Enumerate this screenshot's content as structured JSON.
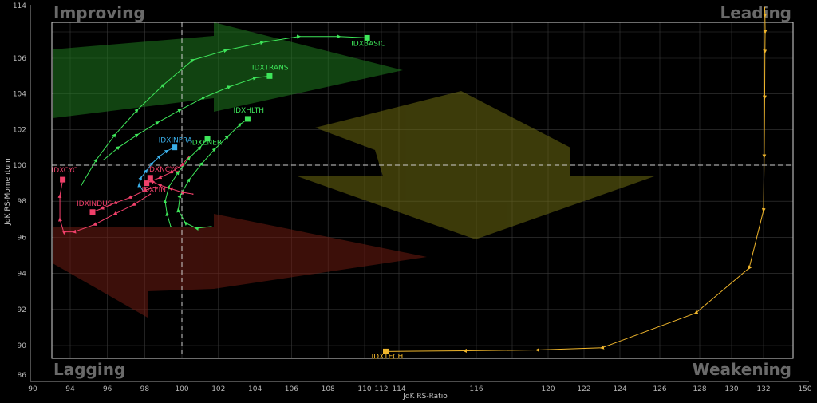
{
  "chart_data": {
    "type": "scatter",
    "title": "",
    "xlabel": "JdK RS-Ratio",
    "ylabel": "JdK RS-Momentum",
    "quadrants": {
      "top_left": "Improving",
      "top_right": "Leading",
      "bottom_left": "Lagging",
      "bottom_right": "Weakening"
    },
    "colors": {
      "improving": "#2c7a2c",
      "weakening": "#7a7a1e",
      "lagging": "#7a2418",
      "grid": "#3a3a3a",
      "frame": "#d8d8d8",
      "reference": "#cfcfcf"
    },
    "x_ticks_main": [
      "90",
      "94",
      "96",
      "98",
      "100",
      "102",
      "104",
      "106",
      "108",
      "110",
      "112",
      "114",
      "116",
      "120",
      "122",
      "124",
      "126",
      "128",
      "130",
      "132",
      "150"
    ],
    "y_ticks_main": [
      "86",
      "90",
      "92",
      "94",
      "96",
      "98",
      "100",
      "102",
      "104",
      "106",
      "114"
    ],
    "xlim": [
      93,
      133
    ],
    "ylim": [
      89.2,
      113.8
    ],
    "center": [
      100,
      100
    ],
    "series": [
      {
        "name": "IDXBASIC",
        "color": "#3ee65a",
        "x": [
          94.6,
          95.4,
          96.4,
          97.6,
          99.0,
          100.6,
          102.4,
          104.4,
          106.4,
          108.6,
          110.3
        ],
        "y": [
          98.9,
          100.3,
          101.7,
          103.1,
          104.5,
          105.9,
          107.2,
          108.4,
          109.3,
          109.3,
          109.1
        ]
      },
      {
        "name": "IDXTRANS",
        "color": "#3ee65a",
        "x": [
          95.8,
          96.6,
          97.6,
          98.7,
          99.9,
          101.2,
          102.6,
          104.0,
          104.8
        ],
        "y": [
          100.3,
          101.0,
          101.7,
          102.4,
          103.1,
          103.8,
          104.4,
          104.9,
          105.0
        ]
      },
      {
        "name": "IDXHLTH",
        "color": "#3ee65a",
        "x": [
          101.6,
          100.8,
          100.2,
          99.8,
          99.9,
          100.4,
          101.1,
          101.8,
          102.5,
          103.2,
          103.6
        ],
        "y": [
          96.6,
          96.5,
          96.8,
          97.5,
          98.3,
          99.2,
          100.1,
          100.9,
          101.6,
          102.3,
          102.6
        ]
      },
      {
        "name": "IDXENER",
        "color": "#3ee65a",
        "x": [
          99.4,
          99.2,
          99.1,
          99.3,
          99.8,
          100.4,
          101.0,
          101.4
        ],
        "y": [
          96.6,
          97.3,
          98.0,
          98.8,
          99.6,
          100.4,
          101.0,
          101.5
        ]
      },
      {
        "name": "IDXINFRA",
        "color": "#3aaee8",
        "x": [
          97.9,
          97.7,
          97.8,
          98.1,
          98.4,
          98.8,
          99.2,
          99.6
        ],
        "y": [
          98.6,
          98.9,
          99.3,
          99.7,
          100.1,
          100.5,
          100.8,
          101.0
        ]
      },
      {
        "name": "IDXCYC",
        "color": "#f0406a",
        "x": [
          98.3,
          97.4,
          96.4,
          95.3,
          94.2,
          93.3,
          92.9,
          92.9,
          93.2
        ],
        "y": [
          98.4,
          97.8,
          97.3,
          96.7,
          96.3,
          96.3,
          97.0,
          98.3,
          99.2
        ]
      },
      {
        "name": "IDXINDUS",
        "color": "#f0406a",
        "x": [
          98.6,
          98.0,
          97.2,
          96.4,
          95.7,
          95.2
        ],
        "y": [
          98.8,
          98.6,
          98.2,
          97.9,
          97.6,
          97.4
        ]
      },
      {
        "name": "IDXNCYC",
        "color": "#f0406a",
        "x": [
          100.6,
          100.0,
          99.4,
          98.8,
          98.4,
          98.3
        ],
        "y": [
          98.4,
          98.5,
          98.7,
          98.9,
          99.1,
          99.3
        ]
      },
      {
        "name": "IDXFIN",
        "color": "#f0406a",
        "x": [
          100.4,
          100.0,
          99.4,
          98.8,
          98.3,
          98.1
        ],
        "y": [
          100.5,
          100.0,
          99.6,
          99.3,
          99.1,
          99.0
        ]
      },
      {
        "name": "IDXTECH",
        "color": "#f0b62c",
        "x": [
          132.5,
          132.6,
          132.7,
          132.6,
          132.5,
          132.3,
          132.0,
          131.1,
          127.8,
          123.0,
          119.4,
          115.7,
          112.5
        ],
        "y": [
          113.7,
          112.5,
          110.0,
          107.0,
          103.8,
          100.5,
          97.5,
          94.3,
          91.8,
          89.7,
          89.4,
          89.3,
          89.2
        ]
      }
    ]
  },
  "labels": {
    "IDXBASIC": "IDXBASIC",
    "IDXTRANS": "IDXTRANS",
    "IDXHLTH": "IDXHLTH",
    "IDXENER": "IDXENER",
    "IDXINFRA": "IDXINFRA",
    "IDXCYC": "IDXCYC",
    "IDXINDUS": "IDXINDUS",
    "IDXNCYC": "IDXNCYC",
    "IDXFIN": "IDXFIN",
    "IDXTECH": "IDXTECH"
  }
}
